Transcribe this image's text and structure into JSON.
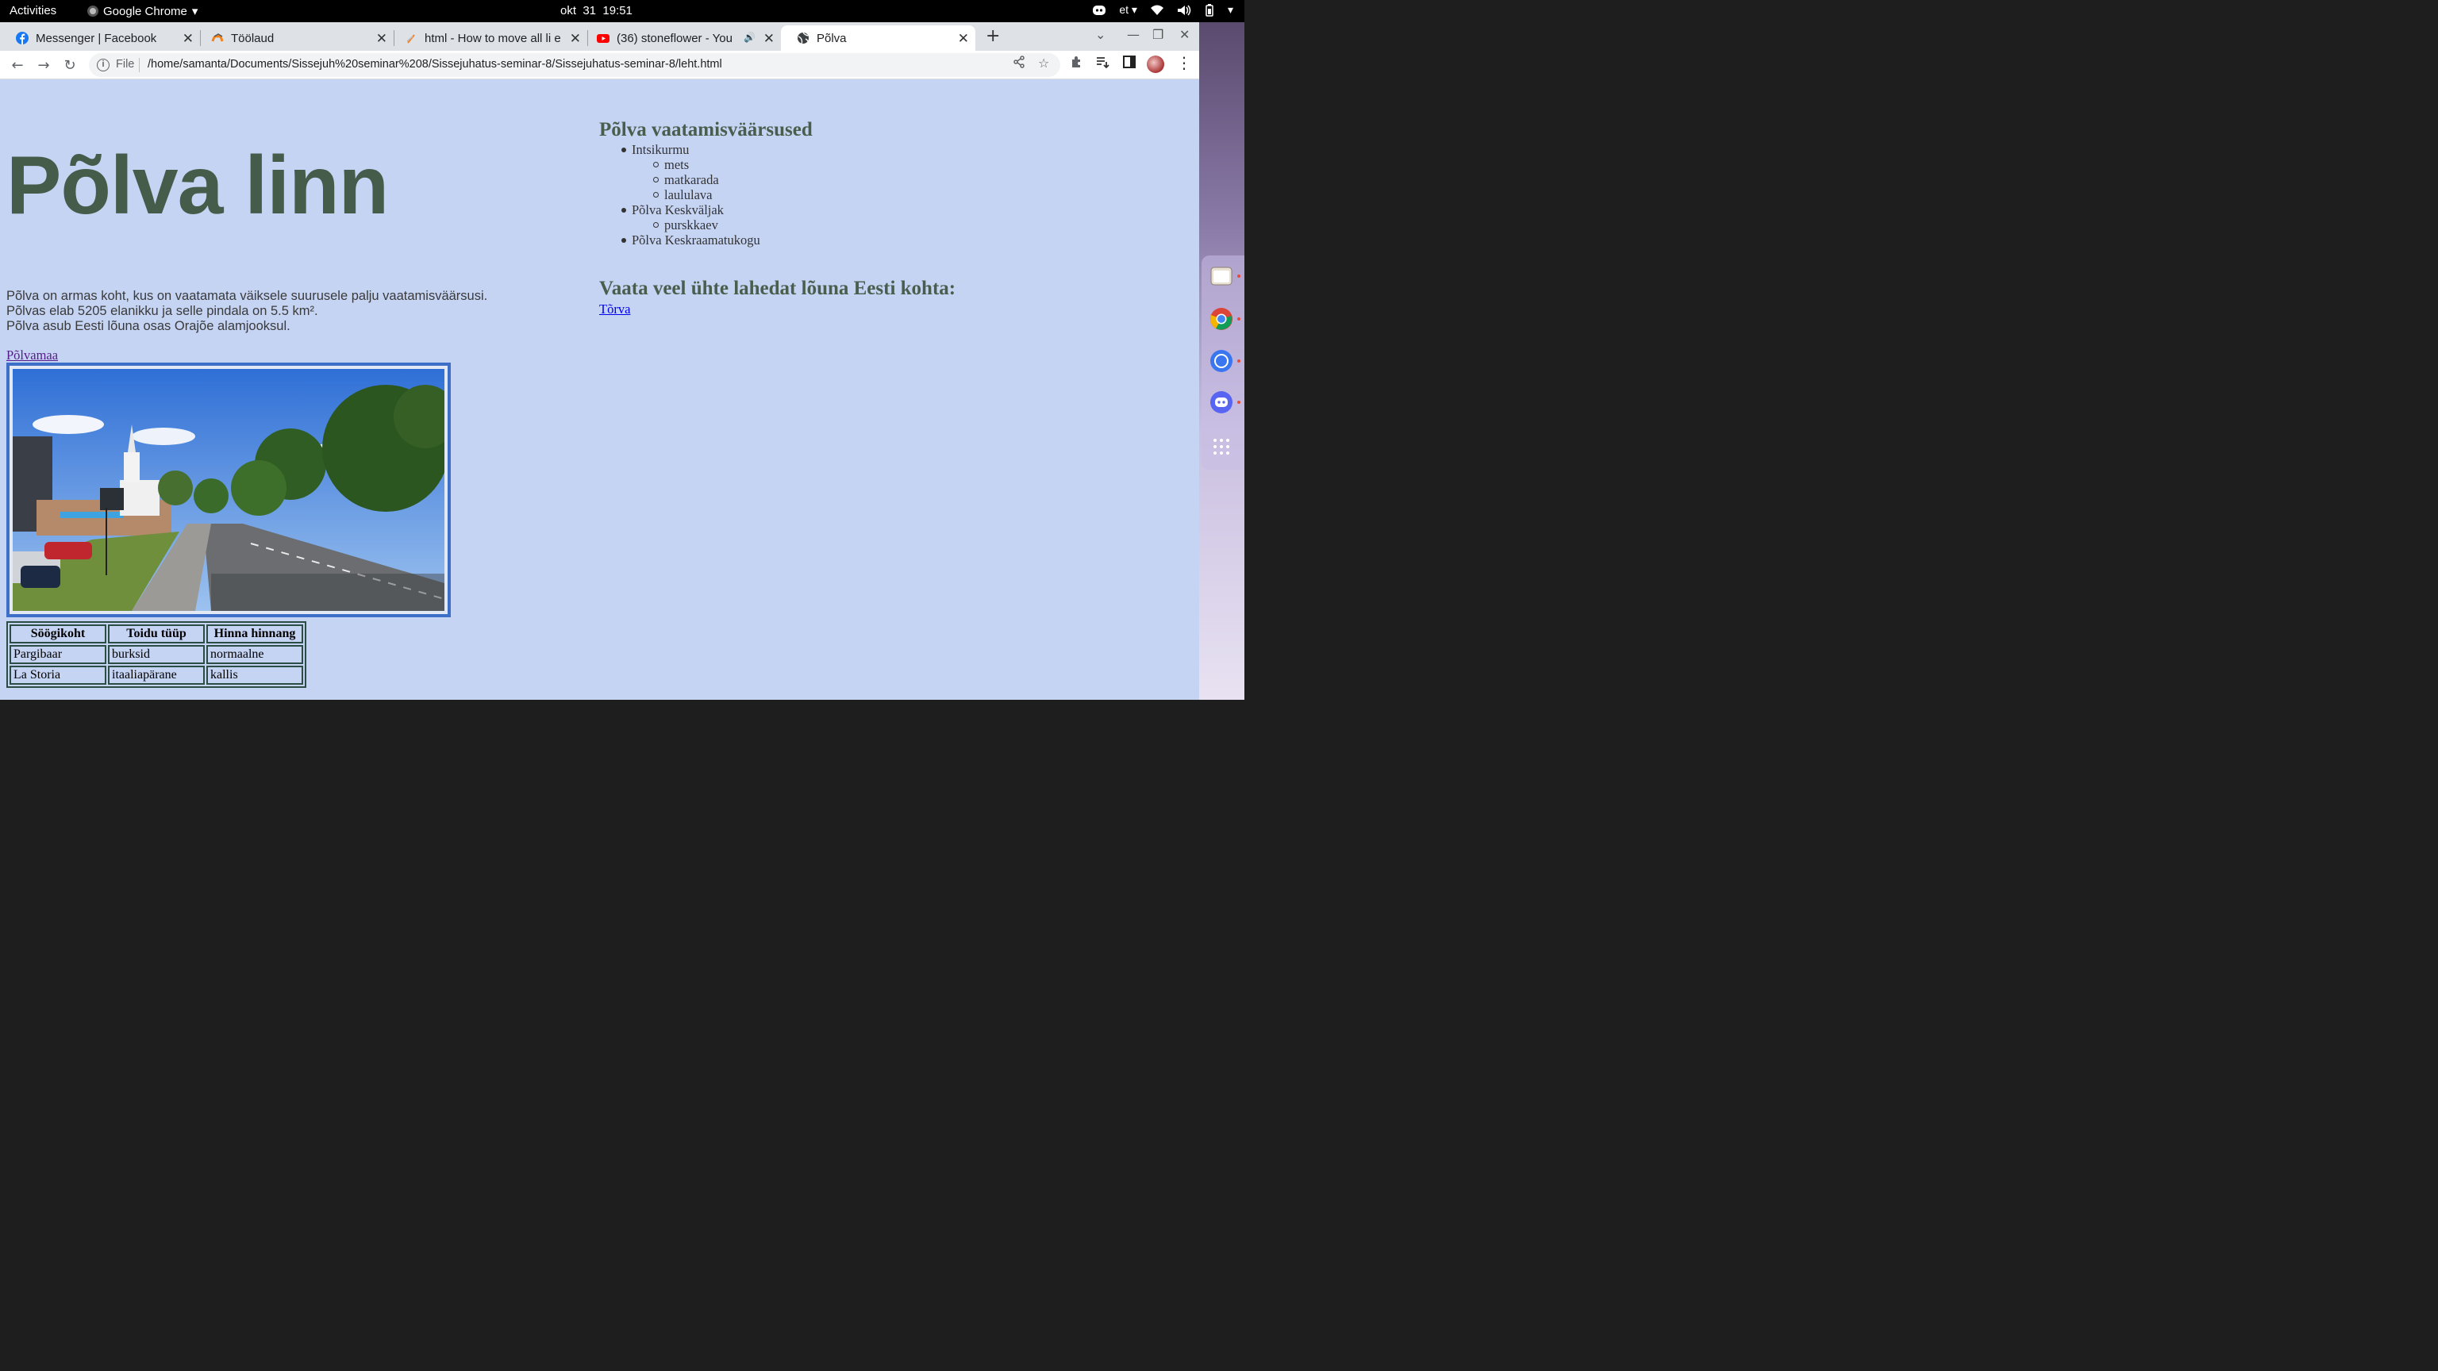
{
  "topbar": {
    "activities": "Activities",
    "app_name": "Google Chrome",
    "clock": "okt  31  19:51",
    "language": "et"
  },
  "tabs": [
    {
      "title": "Messenger | Facebook",
      "icon": "facebook-icon"
    },
    {
      "title": "Töölaud",
      "icon": "moodle-icon"
    },
    {
      "title": "html - How to move all li e",
      "icon": "stackoverflow-icon"
    },
    {
      "title": "(36) stoneflower - You",
      "icon": "youtube-icon"
    },
    {
      "title": "Põlva",
      "icon": "globe-icon",
      "active": true
    }
  ],
  "addressbar": {
    "scheme": "File",
    "url": "/home/samanta/Documents/Sissejuh%20seminar%208/Sissejuhatus-seminar-8/Sissejuhatus-seminar-8/leht.html"
  },
  "page": {
    "title": "Põlva linn",
    "intro": [
      "Põlva on armas koht, kus on vaatamata väiksele suurusele palju vaatamisväärsusi.",
      "Põlvas elab 5205 elanikku ja selle pindala on 5.5 km².",
      "Põlva asub Eesti lõuna osas Orajõe alamjooksul."
    ],
    "county_link": "Põlvamaa",
    "table": {
      "headers": [
        "Söögikoht",
        "Toidu tüüp",
        "Hinna hinnang"
      ],
      "rows": [
        [
          "Pargibaar",
          "burksid",
          "normaalne"
        ],
        [
          "La Storia",
          "itaaliapärane",
          "kallis"
        ]
      ]
    },
    "sights_heading": "Põlva vaatamisväärsused",
    "sights": [
      {
        "name": "Intsikurmu",
        "children": [
          "mets",
          "matkarada",
          "laululava"
        ]
      },
      {
        "name": "Põlva Keskväljak",
        "children": [
          "purskkaev"
        ]
      },
      {
        "name": "Põlva Keskraamatukogu",
        "children": []
      }
    ],
    "more_heading": "Vaata veel ühte lahedat lõuna Eesti kohta:",
    "more_link": "Tõrva"
  },
  "colors": {
    "page_bg": "#c6d4f4",
    "heading": "#465c4a",
    "image_border": "#3d6fc9",
    "table_border": "#2c4d44"
  }
}
